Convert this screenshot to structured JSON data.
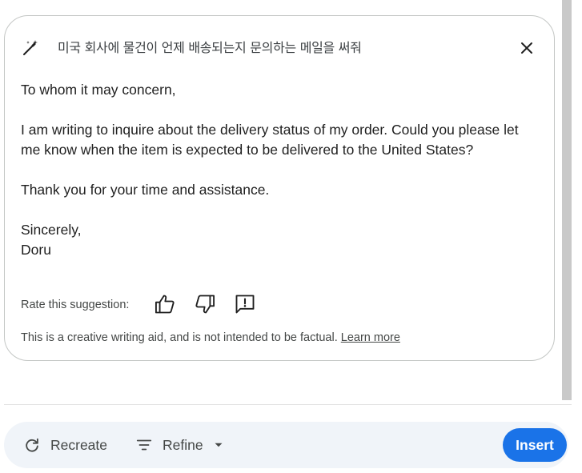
{
  "prompt": {
    "text": "미국 회사에 물건이 언제 배송되는지 문의하는 메일을 써줘"
  },
  "email": {
    "greeting": "To whom it may concern,",
    "paragraph1": "I am writing to inquire about the delivery status of my order. Could you please let me know when the item is expected to be delivered to the United States?",
    "paragraph2": "Thank you for your time and assistance.",
    "closing": "Sincerely,",
    "signature": "Doru"
  },
  "rating": {
    "label": "Rate this suggestion:"
  },
  "disclaimer": {
    "text": "This is a creative writing aid, and is not intended to be factual.",
    "link": "Learn more"
  },
  "toolbar": {
    "recreate_label": "Recreate",
    "refine_label": "Refine",
    "insert_label": "Insert"
  },
  "colors": {
    "accent": "#1a73e8",
    "toolbar_bg": "#f0f4f9",
    "card_border": "#c4c7c5"
  },
  "icons": {
    "header": "magic-wand-icon",
    "close": "close-icon",
    "thumbs_up": "thumbs-up-icon",
    "thumbs_down": "thumbs-down-icon",
    "feedback": "feedback-icon",
    "recreate": "refresh-icon",
    "refine": "filter-lines-icon",
    "dropdown": "caret-down-icon"
  }
}
